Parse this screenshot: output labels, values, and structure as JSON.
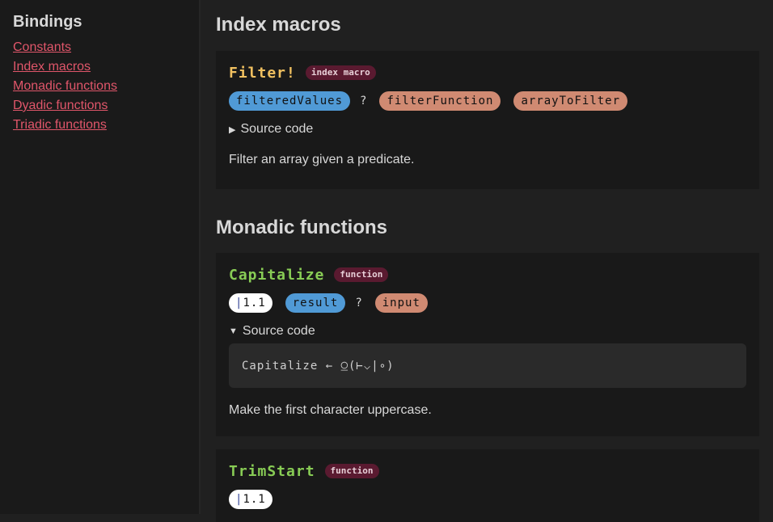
{
  "sidebar": {
    "title": "Bindings",
    "links": [
      "Constants",
      "Index macros",
      "Monadic functions",
      "Dyadic functions",
      "Triadic functions"
    ]
  },
  "sections": [
    {
      "title": "Index macros",
      "items": [
        {
          "name": "Filter!",
          "kind": "index macro",
          "outputs": [
            "filteredValues"
          ],
          "separator": "?",
          "inputs": [
            "filterFunction",
            "arrayToFilter"
          ],
          "source_label": "Source code",
          "source_expanded": false,
          "description": "Filter an array given a predicate."
        }
      ]
    },
    {
      "title": "Monadic functions",
      "items": [
        {
          "name": "Capitalize",
          "kind": "function",
          "version": "1.1",
          "outputs": [
            "result"
          ],
          "separator": "?",
          "inputs": [
            "input"
          ],
          "source_label": "Source code",
          "source_expanded": true,
          "source_code": "Capitalize ← ⍜(⊢⌵|∘)",
          "description": "Make the first character uppercase."
        },
        {
          "name": "TrimStart",
          "kind": "function",
          "version": "1.1"
        }
      ]
    }
  ],
  "colors": {
    "link": "#e0566a",
    "macro_name": "#f0c060",
    "function_name": "#88cc55",
    "output_pill": "#509ad6",
    "input_pill": "#d08a72",
    "kind_badge": "#5a1a30"
  }
}
